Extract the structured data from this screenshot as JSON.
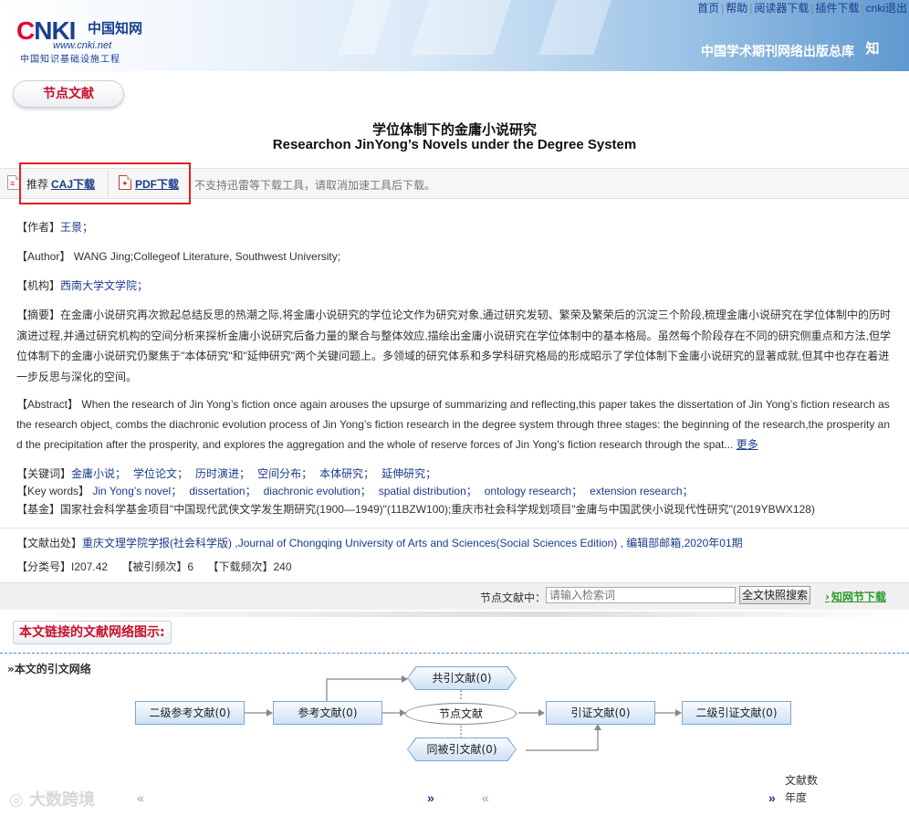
{
  "header": {
    "logo_mark_a": "C",
    "logo_mark_b": "NKI",
    "logo_cn_title": "中国知网",
    "logo_url": "www.cnki.net",
    "logo_tagline": "中国知识基础设施工程",
    "brand_text": "中国学术期刊网络出版总库",
    "brand_seal": "知",
    "links": [
      "首页",
      "帮助",
      "阅读器下载",
      "插件下载",
      "cnki退出"
    ]
  },
  "badge": "节点文献",
  "article": {
    "title_cn": "学位体制下的金庸小说研究",
    "title_en": "Researchon JinYong’s Novels under the Degree System"
  },
  "download": {
    "recommend": "推荐",
    "caj": "CAJ下载",
    "pdf": "PDF下载",
    "note": "不支持迅雷等下载工具，请取消加速工具后下载。"
  },
  "meta": {
    "author_label": "【作者】",
    "author": "王景；",
    "author_en_label": "【Author】",
    "author_en": "WANG Jing;Collegeof Literature, Southwest University;",
    "org_label": "【机构】",
    "org": "西南大学文学院；",
    "abstract_label": "【摘要】",
    "abstract": "在金庸小说研究再次掀起总结反思的热潮之际,将金庸小说研究的学位论文作为研究对象,通过研究发轫、繁荣及繁荣后的沉淀三个阶段,梳理金庸小说研究在学位体制中的历时演进过程,并通过研究机构的空间分析来探析金庸小说研究后备力量的聚合与整体效应,描绘出金庸小说研究在学位体制中的基本格局。虽然每个阶段存在不同的研究侧重点和方法,但学位体制下的金庸小说研究仍聚焦于\"本体研究\"和\"延伸研究\"两个关键问题上。多领域的研究体系和多学科研究格局的形成昭示了学位体制下金庸小说研究的显著成就,但其中也存在着进一步反思与深化的空间。",
    "abstract_en_label": "【Abstract】",
    "abstract_en": "When the research of Jin Yong’s fiction once again arouses the upsurge of summarizing and reflecting,this paper takes the dissertation of Jin Yong’s fiction research as the research object, combs the diachronic evolution process of Jin Yong’s fiction research in the degree system through three stages: the beginning of the research,the prosperity and the precipitation after the prosperity, and explores the aggregation and the whole of reserve forces of Jin Yong’s fiction research through the spat...",
    "more": "更多",
    "kw_label": "【关键词】",
    "keywords": [
      "金庸小说；",
      "学位论文；",
      "历时演进；",
      "空间分布；",
      "本体研究；",
      "延伸研究；"
    ],
    "kw_en_label": "【Key words】",
    "keywords_en": [
      "Jin Yong’s novel；",
      "dissertation；",
      "diachronic evolution；",
      "spatial distribution；",
      "ontology research；",
      "extension research；"
    ],
    "fund_label": "【基金】",
    "fund": "国家社会科学基金项目\"中国现代武侠文学发生期研究(1900—1949)\"(11BZW100);重庆市社会科学规划项目\"金庸与中国武侠小说现代性研究\"(2019YBWX128)",
    "source_label": "【文献出处】",
    "source_cn": "重庆文理学院学报(社会科学版)",
    "source_en": "Journal of Chongqing University of Arts and Sciences(Social Sciences Edition)",
    "source_dept": "编辑部邮箱",
    "source_issue": ",2020年01期",
    "class_label": "【分类号】",
    "class_value": "I207.42",
    "cited_label": "【被引频次】",
    "cited_value": "6",
    "dl_label": "【下载频次】",
    "dl_value": "240"
  },
  "search": {
    "label": "节点文献中：",
    "placeholder": "请输入检索词",
    "button": "全文快照搜索",
    "cnki_link": "知网节下载"
  },
  "network": {
    "title": "本文链接的文献网络图示:",
    "subtitle": "»本文的引文网络",
    "nodes": {
      "ref2": "二级参考文献(0)",
      "ref": "参考文献(0)",
      "node": "节点文献",
      "cite": "引证文献(0)",
      "cite2": "二级引证文献(0)",
      "co_cite": "共引文献(0)",
      "co_cited": "同被引文献(0)"
    },
    "legend_count": "文献数",
    "legend_year": "年度",
    "watermark": "大数跨境"
  }
}
